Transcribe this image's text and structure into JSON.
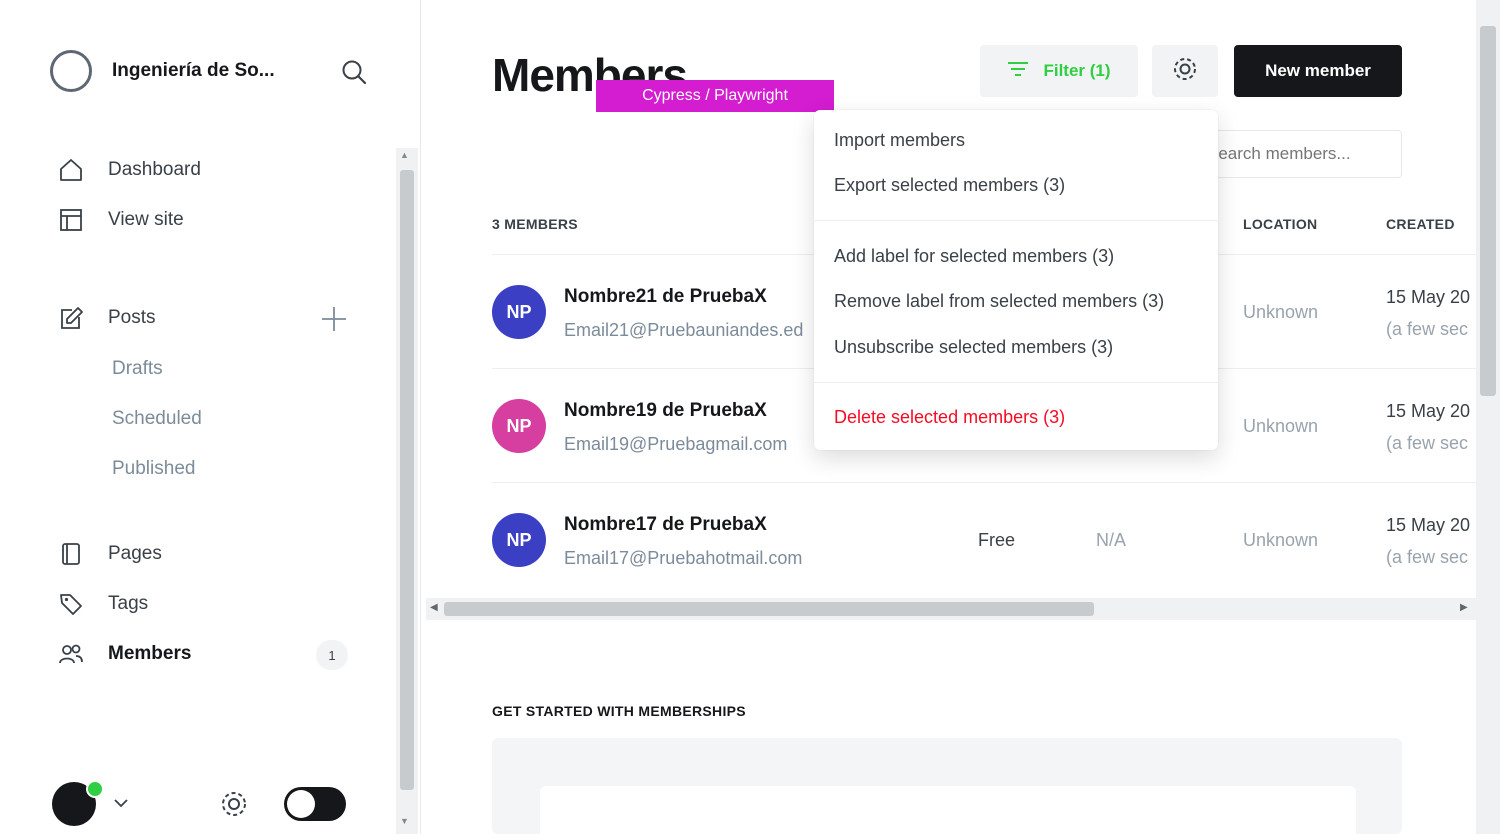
{
  "sidebar": {
    "site_name": "Ingeniería de So...",
    "nav": {
      "dashboard": "Dashboard",
      "view_site": "View site",
      "posts": "Posts",
      "drafts": "Drafts",
      "scheduled": "Scheduled",
      "published": "Published",
      "pages": "Pages",
      "tags": "Tags",
      "members": "Members",
      "members_count": "1"
    }
  },
  "header": {
    "title": "Members",
    "username_tag": "Cypress / Playwright",
    "filter_label": "Filter (1)",
    "new_member_label": "New member",
    "search_placeholder": "Search members..."
  },
  "table": {
    "count_label": "3 MEMBERS",
    "columns": {
      "location": "LOCATION",
      "created": "CREATED"
    },
    "rows": [
      {
        "initials": "NP",
        "avatar_color": "#3a3fc4",
        "name": "Nombre21 de PruebaX",
        "email": "Email21@Pruebauniandes.ed",
        "status": "",
        "open_rate": "",
        "location": "Unknown",
        "created": "15 May 20",
        "created_rel": "(a few sec"
      },
      {
        "initials": "NP",
        "avatar_color": "#d63f9f",
        "name": "Nombre19 de PruebaX",
        "email": "Email19@Pruebagmail.com",
        "status": "",
        "open_rate": "",
        "location": "Unknown",
        "created": "15 May 20",
        "created_rel": "(a few sec"
      },
      {
        "initials": "NP",
        "avatar_color": "#3a3fc4",
        "name": "Nombre17 de PruebaX",
        "email": "Email17@Pruebahotmail.com",
        "status": "Free",
        "open_rate": "N/A",
        "location": "Unknown",
        "created": "15 May 20",
        "created_rel": "(a few sec"
      }
    ]
  },
  "dropdown": {
    "import": "Import members",
    "export": "Export selected members (3)",
    "add_label": "Add label for selected members (3)",
    "remove_label": "Remove label from selected members (3)",
    "unsubscribe": "Unsubscribe selected members (3)",
    "delete": "Delete selected members (3)"
  },
  "get_started": {
    "title": "GET STARTED WITH MEMBERSHIPS"
  },
  "colors": {
    "accent_green": "#30cf43",
    "danger": "#f50b23",
    "dark": "#15171a"
  }
}
